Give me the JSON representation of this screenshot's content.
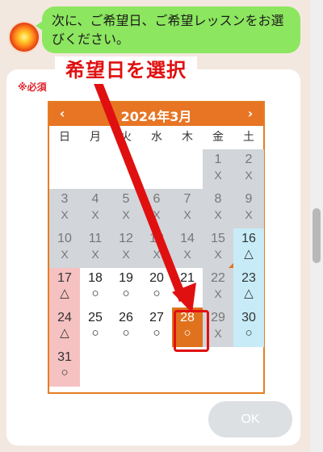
{
  "chat": {
    "message": "次に、ご希望日、ご希望レッスンをお選びください。"
  },
  "form": {
    "required_label": "※必須",
    "ok_label": "OK"
  },
  "annotation": {
    "text": "希望日を選択"
  },
  "calendar": {
    "title": "2024年3月",
    "prev_icon": "‹",
    "next_icon": "›",
    "weekdays": [
      "日",
      "月",
      "火",
      "水",
      "木",
      "金",
      "土"
    ],
    "days": [
      {
        "day": "1",
        "mark": "X"
      },
      {
        "day": "2",
        "mark": "X"
      },
      {
        "day": "3",
        "mark": "X"
      },
      {
        "day": "4",
        "mark": "X"
      },
      {
        "day": "5",
        "mark": "X"
      },
      {
        "day": "6",
        "mark": "X"
      },
      {
        "day": "7",
        "mark": "X"
      },
      {
        "day": "8",
        "mark": "X"
      },
      {
        "day": "9",
        "mark": "X"
      },
      {
        "day": "10",
        "mark": "X"
      },
      {
        "day": "11",
        "mark": "X"
      },
      {
        "day": "12",
        "mark": "X"
      },
      {
        "day": "13",
        "mark": "X"
      },
      {
        "day": "14",
        "mark": "X"
      },
      {
        "day": "15",
        "mark": "X"
      },
      {
        "day": "16",
        "mark": "△"
      },
      {
        "day": "17",
        "mark": "△"
      },
      {
        "day": "18",
        "mark": "○"
      },
      {
        "day": "19",
        "mark": "○"
      },
      {
        "day": "20",
        "mark": "○"
      },
      {
        "day": "21",
        "mark": "○"
      },
      {
        "day": "22",
        "mark": "X"
      },
      {
        "day": "23",
        "mark": "△"
      },
      {
        "day": "24",
        "mark": "△"
      },
      {
        "day": "25",
        "mark": "○"
      },
      {
        "day": "26",
        "mark": "○"
      },
      {
        "day": "27",
        "mark": "○"
      },
      {
        "day": "28",
        "mark": "○"
      },
      {
        "day": "29",
        "mark": "X"
      },
      {
        "day": "30",
        "mark": "○"
      },
      {
        "day": "31",
        "mark": "○"
      }
    ],
    "selected_day": "28",
    "colors": {
      "header": "#e77524",
      "past": "#d2d5d9",
      "sunday": "#f6c1c1",
      "saturday": "#c7ecf8",
      "selected": "#e0721e"
    }
  }
}
